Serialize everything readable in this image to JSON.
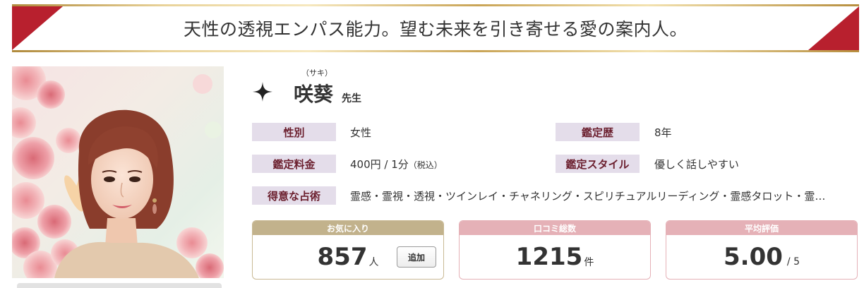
{
  "banner": {
    "text": "天性の透視エンパス能力。望む未来を引き寄せる愛の案内人。"
  },
  "profile": {
    "name": "咲葵",
    "name_reading": "（サキ）",
    "name_suffix": "先生",
    "star_icon": "four-point-star-icon"
  },
  "attributes": {
    "gender_label": "性別",
    "gender_value": "女性",
    "history_label": "鑑定歴",
    "history_value": "8年",
    "fee_label": "鑑定料金",
    "fee_value": "400円 / 1分",
    "fee_tax": "（税込）",
    "style_label": "鑑定スタイル",
    "style_value": "優しく話しやすい",
    "skills_label": "得意な占術",
    "skills_value": "霊感・霊視・透視・ツインレイ・チャネリング・スピリチュアルリーディング・霊感タロット・霊…"
  },
  "stats": {
    "favorites": {
      "label": "お気に入り",
      "value": "857",
      "unit": "人",
      "add_button": "追加",
      "header_color": "#c2b28c"
    },
    "reviews": {
      "label": "口コミ総数",
      "value": "1215",
      "unit": "件",
      "header_color": "#e5b1b7"
    },
    "rating": {
      "label": "平均評価",
      "value": "5.00",
      "unit": "/ 5",
      "header_color": "#e5b1b7"
    }
  },
  "colors": {
    "banner_red": "#b8202e",
    "tag_bg": "#e4ddea",
    "tag_text": "#6b1f2e"
  }
}
